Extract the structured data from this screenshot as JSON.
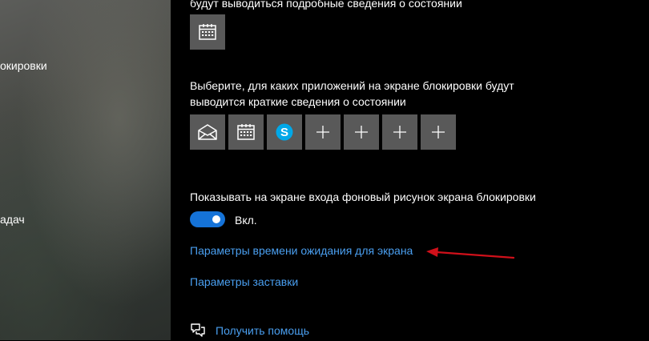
{
  "sidebar": {
    "items": [
      {
        "label": "окировки"
      },
      {
        "label": "адач"
      }
    ]
  },
  "main": {
    "detailed_status_text": "будут выводиться подробные сведения о состоянии",
    "quick_status_line1": "Выберите, для каких приложений на экране блокировки будут",
    "quick_status_line2": "выводится краткие сведения о состоянии",
    "quick_apps": [
      {
        "icon": "mail-icon"
      },
      {
        "icon": "calendar-icon"
      },
      {
        "icon": "skype-icon",
        "letter": "S"
      },
      {
        "icon": "plus-icon"
      },
      {
        "icon": "plus-icon"
      },
      {
        "icon": "plus-icon"
      },
      {
        "icon": "plus-icon"
      }
    ],
    "background_text": "Показывать на экране входа фоновый рисунок экрана блокировки",
    "toggle_state": "Вкл.",
    "screen_timeout_link": "Параметры времени ожидания для экрана",
    "screensaver_link": "Параметры заставки",
    "help_link": "Получить помощь"
  },
  "colors": {
    "accent": "#1573d8",
    "link": "#4a9ff0",
    "tile": "#595959",
    "annotation_arrow": "#d0101a"
  }
}
